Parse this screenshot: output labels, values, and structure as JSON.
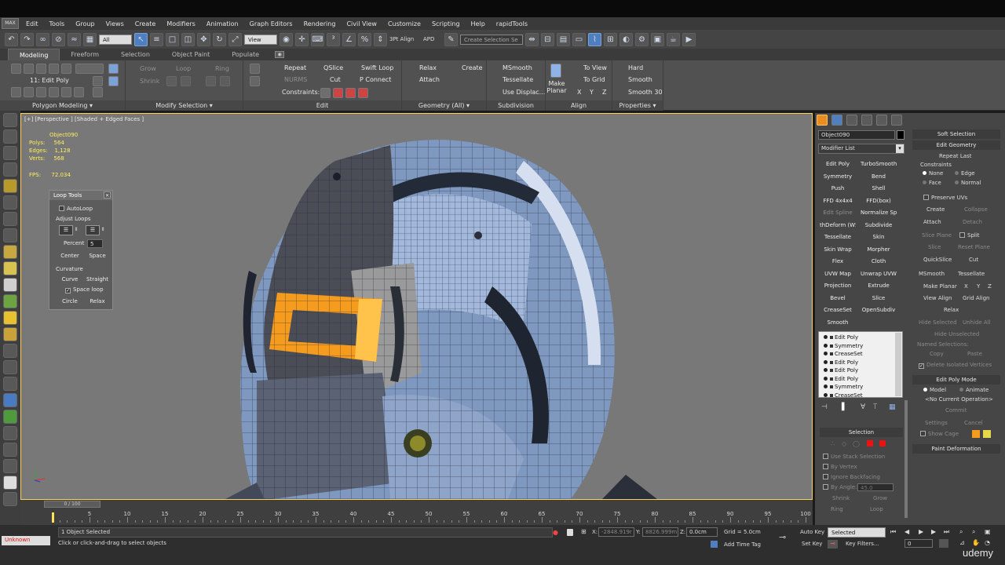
{
  "menu": {
    "logo": "MAX",
    "items": [
      "Edit",
      "Tools",
      "Group",
      "Views",
      "Create",
      "Modifiers",
      "Animation",
      "Graph Editors",
      "Rendering",
      "Civil View",
      "Customize",
      "Scripting",
      "Help",
      "rapidTools"
    ]
  },
  "toolbar": {
    "filter_select": "All",
    "view_select": "View",
    "align_label": "3Pt Align",
    "apd_label": "APD",
    "selection_set_placeholder": "Create Selection Se"
  },
  "ribbon": {
    "tabs": [
      "Modeling",
      "Freeform",
      "Selection",
      "Object Paint",
      "Populate"
    ],
    "active_tab": "Modeling",
    "sublabel": "11: Edit Poly",
    "panels": {
      "polygon_modeling": "Polygon Modeling",
      "modify_selection": "Modify Selection",
      "edit": "Edit",
      "geometry": "Geometry (All)",
      "subdivision": "Subdivision",
      "align": "Align",
      "properties": "Properties"
    },
    "mod_sel_buttons": [
      "Grow",
      "Loop",
      "Ring",
      "Shrink"
    ],
    "edit_buttons": {
      "repeat": "Repeat",
      "qslice": "QSlice",
      "swift_loop": "Swift Loop",
      "nurms": "NURMS",
      "cut": "Cut",
      "p_connect": "P Connect",
      "constraints": "Constraints:"
    },
    "geometry_buttons": {
      "relax": "Relax",
      "create": "Create",
      "attach": "Attach"
    },
    "subdivision_buttons": {
      "msmooth": "MSmooth",
      "tessellate": "Tessellate",
      "use_displace": "Use Displac..."
    },
    "align_buttons": {
      "make_planar": "Make Planar",
      "to_view": "To View",
      "to_grid": "To Grid",
      "x": "X",
      "y": "Y",
      "z": "Z"
    },
    "properties_buttons": {
      "hard": "Hard",
      "smooth": "Smooth",
      "smooth30": "Smooth 30"
    }
  },
  "viewport": {
    "label": "[+] [Perspective ] [Shaded + Edged Faces ]",
    "object_name": "Object090",
    "polys_label": "Polys:",
    "polys": "564",
    "edges_label": "Edges:",
    "edges": "1,128",
    "verts_label": "Verts:",
    "verts": "568",
    "fps_label": "FPS:",
    "fps": "72.034",
    "colors": {
      "model": "#7f98bf",
      "selection": "#f59b1e",
      "border": "#ffd15a"
    }
  },
  "loop_tools": {
    "title": "Loop Tools",
    "autoloop": "AutoLoop",
    "adjust_loops": "Adjust Loops",
    "percent_label": "Percent",
    "percent_value": "5",
    "center": "Center",
    "space": "Space",
    "curvature": "Curvature",
    "curve": "Curve",
    "straight": "Straight",
    "space_loop": "Space loop",
    "circle": "Circle",
    "relax": "Relax"
  },
  "timeline": {
    "slider": "0 / 100",
    "ticks": [
      5,
      10,
      15,
      20,
      25,
      30,
      35,
      40,
      45,
      50,
      55,
      60,
      65,
      70,
      75,
      80,
      85,
      90,
      95,
      100
    ]
  },
  "status": {
    "unknown": "Unknown",
    "selected": "1 Object Selected",
    "prompt": "Click or click-and-drag to select objects",
    "x": "-2848.919r",
    "y": "8826.999m",
    "z": "0.0cm",
    "grid": "Grid = 5.0cm",
    "add_time_tag": "Add Time Tag",
    "auto_key": "Auto Key",
    "set_key": "Set Key",
    "key_mode": "Selected",
    "key_filters": "Key Filters...",
    "frame": "0",
    "watermark": "udemy"
  },
  "command_panel": {
    "object_name": "Object090",
    "modifier_list": "Modifier List",
    "modifier_buttons": [
      [
        "Edit Poly",
        "TurboSmooth"
      ],
      [
        "Symmetry",
        "Bend"
      ],
      [
        "Push",
        "Shell"
      ],
      [
        "FFD 4x4x4",
        "FFD(box)"
      ],
      [
        "Edit Spline",
        "Normalize Spl."
      ],
      [
        "thDeform (WS",
        "Subdivide"
      ],
      [
        "Tessellate",
        "Skin"
      ],
      [
        "Skin Wrap",
        "Morpher"
      ],
      [
        "Flex",
        "Cloth"
      ],
      [
        "UVW Map",
        "Unwrap UVW"
      ],
      [
        "Projection",
        "Extrude"
      ],
      [
        "Bevel",
        "Slice"
      ],
      [
        "CreaseSet",
        "OpenSubdiv"
      ],
      [
        "Smooth",
        ""
      ]
    ],
    "stack": [
      "Edit Poly",
      "Symmetry",
      "CreaseSet",
      "Edit Poly",
      "Edit Poly",
      "Edit Poly",
      "Symmetry",
      "CreaseSet"
    ],
    "selection_title": "Selection",
    "selection_options": [
      "Use Stack Selection",
      "By Vertex",
      "Ignore Backfacing",
      "By Angle:"
    ],
    "by_angle_value": "45.0",
    "sel_buttons": [
      "Shrink",
      "Grow",
      "Ring",
      "Loop"
    ]
  },
  "right_panel": {
    "soft_selection": "Soft Selection",
    "edit_geometry": "Edit Geometry",
    "repeat_last": "Repeat Last",
    "constraints": "Constraints",
    "none": "None",
    "edge": "Edge",
    "face": "Face",
    "normal": "Normal",
    "preserve_uvs": "Preserve UVs",
    "create": "Create",
    "collapse": "Collapse",
    "attach": "Attach",
    "detach": "Detach",
    "slice_plane": "Slice Plane",
    "split": "Split",
    "slice": "Slice",
    "reset_plane": "Reset Plane",
    "quickslice": "QuickSlice",
    "cut": "Cut",
    "msmooth": "MSmooth",
    "tessellate": "Tessellate",
    "make_planar": "Make Planar",
    "xyz": [
      "X",
      "Y",
      "Z"
    ],
    "view_align": "View Align",
    "grid_align": "Grid Align",
    "relax": "Relax",
    "hide_selected": "Hide Selected",
    "unhide_all": "Unhide All",
    "hide_unselected": "Hide Unselected",
    "named_selections": "Named Selections:",
    "copy": "Copy",
    "paste": "Paste",
    "delete_isolated": "Delete Isolated Vertices",
    "edit_poly_mode": "Edit Poly Mode",
    "model": "Model",
    "animate": "Animate",
    "no_current_op": "<No Current Operation>",
    "commit": "Commit",
    "settings": "Settings",
    "cancel": "Cancel",
    "show_cage": "Show Cage",
    "paint_deformation": "Paint Deformation"
  }
}
